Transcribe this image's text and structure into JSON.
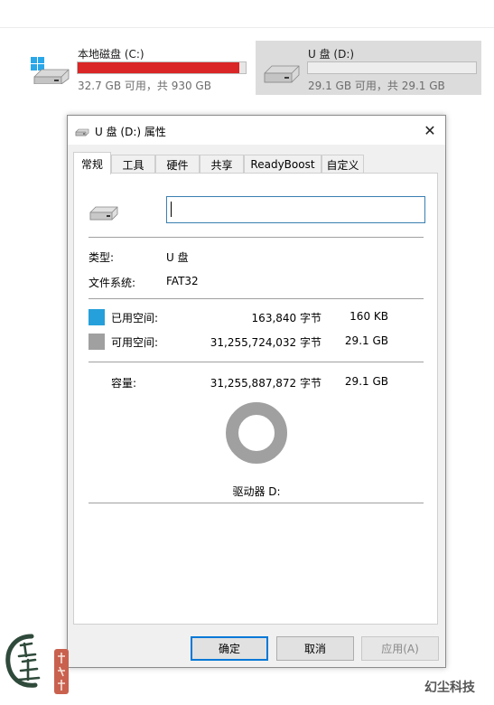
{
  "explorer": {
    "drives": [
      {
        "name": "本地磁盘 (C:)",
        "free_text": "32.7 GB 可用，共 930 GB",
        "used_fraction": 0.965,
        "bar_color": "#da2626",
        "icon": "windows-drive-icon"
      },
      {
        "name": "U 盘 (D:)",
        "free_text": "29.1 GB 可用，共 29.1 GB",
        "used_fraction": 0.0,
        "bar_color": "#26a0da",
        "icon": "usb-drive-icon"
      }
    ]
  },
  "dialog": {
    "title": "U 盘 (D:) 属性",
    "close_symbol": "✕",
    "tabs": [
      "常规",
      "工具",
      "硬件",
      "共享",
      "ReadyBoost",
      "自定义"
    ],
    "active_tab": 0,
    "name_value": "",
    "type_label": "类型:",
    "type_value": "U 盘",
    "fs_label": "文件系统:",
    "fs_value": "FAT32",
    "used_label": "已用空间:",
    "used_bytes": "163,840 字节",
    "used_human": "160 KB",
    "used_color": "#26a0da",
    "free_label": "可用空间:",
    "free_bytes": "31,255,724,032 字节",
    "free_human": "29.1 GB",
    "free_color": "#a0a0a0",
    "capacity_label": "容量:",
    "capacity_bytes": "31,255,887,872 字节",
    "capacity_human": "29.1 GB",
    "used_fraction": 5e-06,
    "drive_label": "驱动器 D:",
    "buttons": {
      "ok": "确定",
      "cancel": "取消",
      "apply": "应用(A)"
    }
  },
  "watermark": {
    "brand": "幻尘科技"
  }
}
